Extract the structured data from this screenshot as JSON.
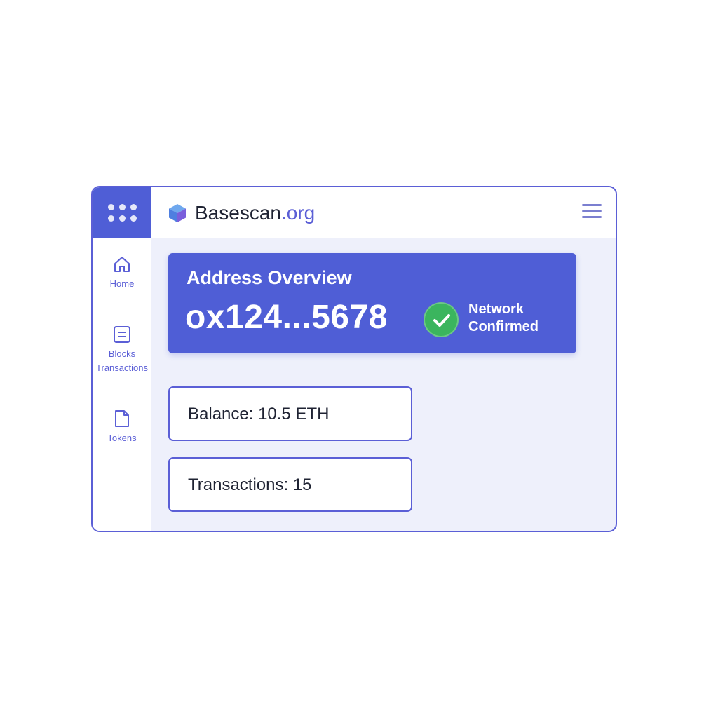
{
  "brand": {
    "name": "Basescan",
    "tld": ".org"
  },
  "sidebar": {
    "items": [
      {
        "label": "Home",
        "icon": "home-icon"
      },
      {
        "label": "Blocks\nTransactions",
        "icon": "list-icon"
      },
      {
        "label": "Tokens",
        "icon": "document-icon"
      }
    ]
  },
  "overview": {
    "title": "Address Overview",
    "address": "ox124...5678",
    "status": "Network Confirmed",
    "status_icon": "check-circle-icon"
  },
  "stats": {
    "balance": "Balance: 10.5 ETH",
    "transactions": "Transactions: 15"
  },
  "colors": {
    "accent": "#4f5ed6",
    "border": "#5b5fd6",
    "success": "#3bb55e",
    "background": "#eef0fb"
  }
}
